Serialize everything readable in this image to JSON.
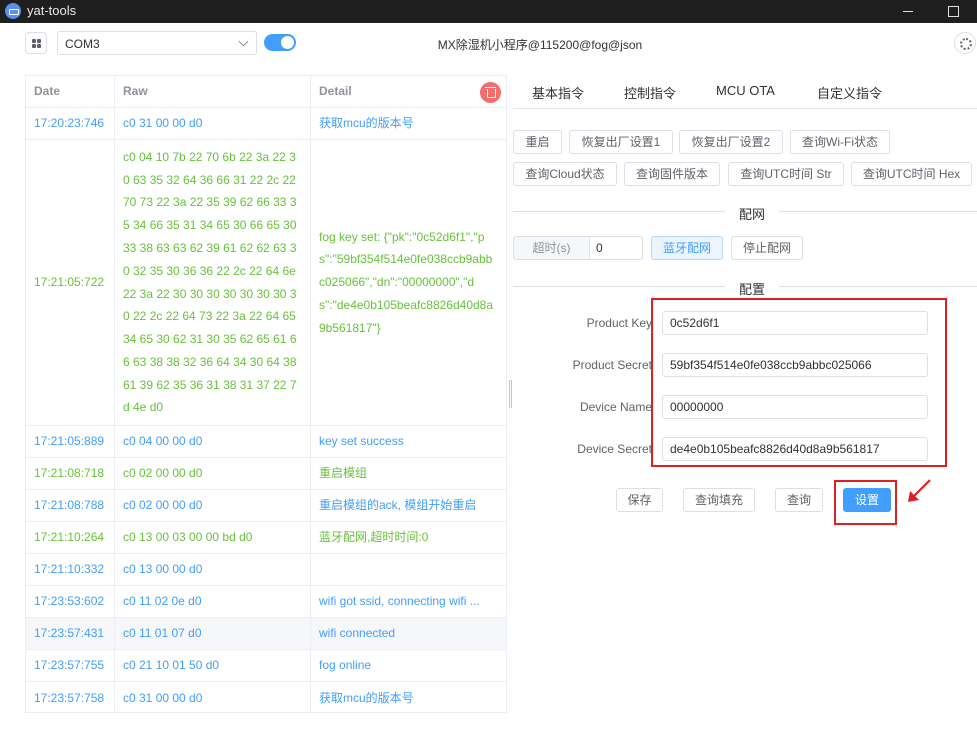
{
  "window": {
    "title": "yat-tools"
  },
  "toolbar": {
    "port": "COM3",
    "app_title": "MX除湿机小程序@115200@fog@json"
  },
  "log": {
    "headers": {
      "date": "Date",
      "raw": "Raw",
      "detail": "Detail"
    },
    "rows": [
      {
        "date": "17:20:23:746",
        "raw": "c0 31 00 00 d0",
        "detail": "获取mcu的版本号"
      },
      {
        "date": "17:21:05:722",
        "raw": "c0 04 10 7b 22 70 6b 22 3a 22 30 63 35 32 64 36 66 31 22 2c 22 70 73 22 3a 22 35 39 62 66 33 35 34 66 35 31 34 65 30 66 65 30 33 38 63 63 62 39 61 62 62 63 30 32 35 30 36 36 22 2c 22 64 6e 22 3a 22 30 30 30 30 30 30 30 30 22 2c 22 64 73 22 3a 22 64 65 34 65 30 62 31 30 35 62 65 61 66 63 38 38 32 36 64 34 30 64 38 61 39 62 35 36 31 38 31 37 22 7d 4e d0",
        "detail": "fog key set: {\"pk\":\"0c52d6f1\",\"ps\":\"59bf354f514e0fe038ccb9abbc025066\",\"dn\":\"00000000\",\"ds\":\"de4e0b105beafc8826d40d8a9b561817\"}"
      },
      {
        "date": "17:21:05:889",
        "raw": "c0 04 00 00 d0",
        "detail": "key set success"
      },
      {
        "date": "17:21:08:718",
        "raw": "c0 02 00 00 d0",
        "detail": "重启模组"
      },
      {
        "date": "17:21:08:788",
        "raw": "c0 02 00 00 d0",
        "detail": "重启模组的ack, 模组开始重启"
      },
      {
        "date": "17:21:10:264",
        "raw": "c0 13 00 03 00 00 bd d0",
        "detail": "蓝牙配网,超时时间:0"
      },
      {
        "date": "17:21:10:332",
        "raw": "c0 13 00 00 d0",
        "detail": ""
      },
      {
        "date": "17:23:53:602",
        "raw": "c0 11 02 0e d0",
        "detail": "wifi got ssid, connecting wifi ..."
      },
      {
        "date": "17:23:57:431",
        "raw": "c0 11 01 07 d0",
        "detail": "wifi connected"
      },
      {
        "date": "17:23:57:755",
        "raw": "c0 21 10 01 50 d0",
        "detail": "fog online"
      },
      {
        "date": "17:23:57:758",
        "raw": "c0 31 00 00 d0",
        "detail": "获取mcu的版本号"
      }
    ]
  },
  "tabs": [
    "基本指令",
    "控制指令",
    "MCU OTA",
    "自定义指令"
  ],
  "basic": {
    "restart": "重启",
    "factory1": "恢复出厂设置1",
    "factory2": "恢复出厂设置2",
    "wifi_status": "查询Wi-Fi状态",
    "cloud_status": "查询Cloud状态",
    "firmware": "查询固件版本",
    "utc_str": "查询UTC时间 Str",
    "utc_hex": "查询UTC时间 Hex"
  },
  "network": {
    "section": "配网",
    "timeout_label": "超时(s)",
    "timeout_value": "0",
    "ble": "蓝牙配网",
    "stop": "停止配网"
  },
  "config": {
    "section": "配置",
    "product_key_label": "Product Key",
    "product_key": "0c52d6f1",
    "product_secret_label": "Product Secret",
    "product_secret": "59bf354f514e0fe038ccb9abbc025066",
    "device_name_label": "Device Name",
    "device_name": "00000000",
    "device_secret_label": "Device Secret",
    "device_secret": "de4e0b105beafc8826d40d8a9b561817",
    "save": "保存",
    "query_fill": "查询填充",
    "query": "查询",
    "set": "设置"
  },
  "colors": {
    "primary": "#409eff",
    "success": "#67c23a",
    "danger": "#f56c6c",
    "annotation": "#e02020"
  }
}
